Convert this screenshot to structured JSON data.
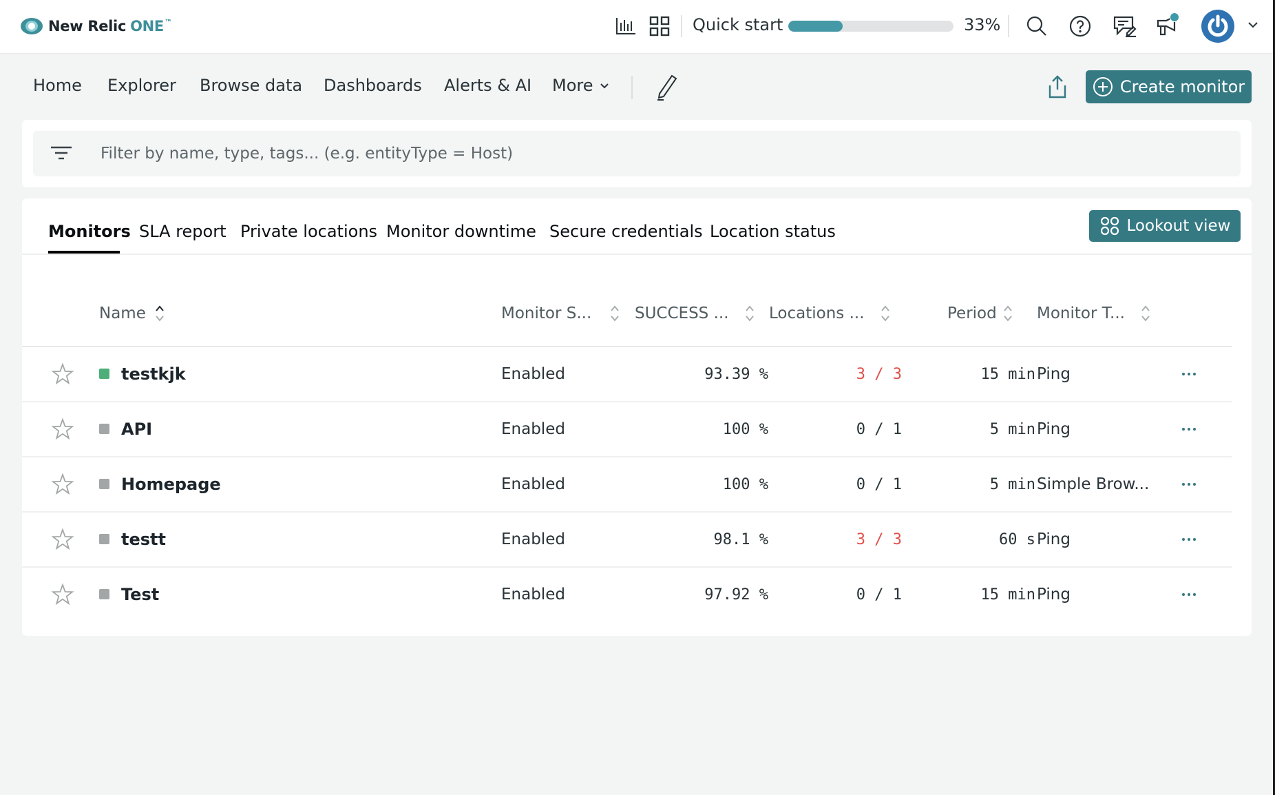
{
  "header": {
    "logo_text": "New Relic",
    "logo_accent": "ONE",
    "logo_tm": "™",
    "quickstart_label": "Quick start",
    "quickstart_progress": 0.33,
    "quickstart_percent_text": "33%",
    "icons": [
      "query-builder-icon",
      "apps-grid-icon",
      "search-icon",
      "help-icon",
      "feedback-icon",
      "announcements-icon",
      "user-avatar",
      "chevron-down-icon"
    ],
    "notification_dot": true
  },
  "nav": {
    "items": [
      {
        "label": "Home"
      },
      {
        "label": "Explorer"
      },
      {
        "label": "Browse data"
      },
      {
        "label": "Dashboards"
      },
      {
        "label": "Alerts & AI"
      },
      {
        "label": "More"
      }
    ],
    "create_monitor_label": "Create monitor"
  },
  "filter": {
    "placeholder": "Filter by name, type, tags... (e.g. entityType = Host)",
    "value": ""
  },
  "tabs": {
    "items": [
      {
        "label": "Monitors",
        "active": true
      },
      {
        "label": "SLA report",
        "active": false
      },
      {
        "label": "Private locations",
        "active": false
      },
      {
        "label": "Monitor downtime",
        "active": false
      },
      {
        "label": "Secure credentials",
        "active": false
      },
      {
        "label": "Location status",
        "active": false
      }
    ],
    "lookout_label": "Lookout view"
  },
  "table": {
    "columns": {
      "name": "Name",
      "monitor_status": "Monitor S...",
      "success": "SUCCESS ...",
      "locations": "Locations ...",
      "period": "Period",
      "monitor_type": "Monitor T..."
    },
    "sort": {
      "column": "name",
      "direction": "ascending"
    },
    "rows": [
      {
        "name": "testkjk",
        "status_color": "#4caf78",
        "monitor_status": "Enabled",
        "success": "93.39 %",
        "locations": "3 / 3",
        "locations_alert": true,
        "period": "15 min",
        "monitor_type": "Ping",
        "favorite": false
      },
      {
        "name": "API",
        "status_color": "#a2a6a7",
        "monitor_status": "Enabled",
        "success": "100 %",
        "locations": "0 / 1",
        "locations_alert": false,
        "period": "5 min",
        "monitor_type": "Ping",
        "favorite": false
      },
      {
        "name": "Homepage",
        "status_color": "#a2a6a7",
        "monitor_status": "Enabled",
        "success": "100 %",
        "locations": "0 / 1",
        "locations_alert": false,
        "period": "5 min",
        "monitor_type": "Simple Brow...",
        "favorite": false
      },
      {
        "name": "testt",
        "status_color": "#a2a6a7",
        "monitor_status": "Enabled",
        "success": "98.1 %",
        "locations": "3 / 3",
        "locations_alert": true,
        "period": "60 s",
        "monitor_type": "Ping",
        "favorite": false
      },
      {
        "name": "Test",
        "status_color": "#a2a6a7",
        "monitor_status": "Enabled",
        "success": "97.92 %",
        "locations": "0 / 1",
        "locations_alert": false,
        "period": "15 min",
        "monitor_type": "Ping",
        "favorite": false
      }
    ]
  },
  "colors": {
    "brand": "#3e8f9a",
    "primary_button": "#357983",
    "progress_fill": "#4599a6",
    "alert_red": "#e0504a",
    "status_ok": "#4caf78",
    "status_unknown": "#a2a6a7"
  }
}
